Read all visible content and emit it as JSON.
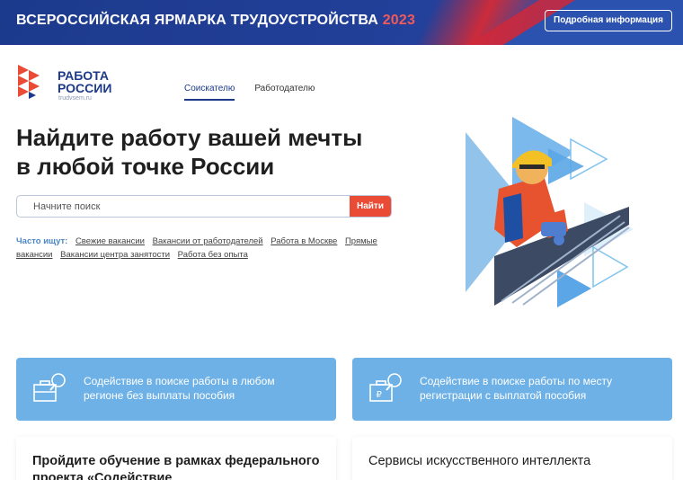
{
  "banner": {
    "title": "ВСЕРОССИЙСКАЯ ЯРМАРКА ТРУДОУСТРОЙСТВА",
    "year": "2023",
    "button": "Подробная информация"
  },
  "logo": {
    "line1": "РАБОТА",
    "line2": "РОССИИ",
    "sub": "trudvsem.ru"
  },
  "nav": {
    "tabs": [
      {
        "label": "Соискателю",
        "active": true
      },
      {
        "label": "Работодателю",
        "active": false
      }
    ]
  },
  "hero": {
    "title_line1": "Найдите работу вашей мечты",
    "title_line2": "в любой точке России"
  },
  "search": {
    "placeholder": "Начните поиск",
    "button": "Найти"
  },
  "often": {
    "label": "Часто ищут:",
    "links": [
      "Свежие вакансии",
      "Вакансии от работодателей",
      "Работа в Москве",
      "Прямые вакансии",
      "Вакансии центра занятости",
      "Работа без опыта"
    ]
  },
  "cards": [
    {
      "text": "Содействие в поиске работы в любом регионе без выплаты пособия",
      "icon": "briefcase-search-icon"
    },
    {
      "text": "Содействие в поиске работы по месту регистрации с выплатой пособия",
      "icon": "briefcase-ruble-search-icon"
    }
  ],
  "cards_white": [
    {
      "title": "Пройдите обучение в рамках федерального проекта «Содействие"
    },
    {
      "title": "Сервисы искусственного интеллекта"
    }
  ],
  "colors": {
    "brand_blue": "#1d3a8a",
    "accent_red": "#e94b35",
    "card_blue": "#6db1e6",
    "link_blue": "#4b86c6"
  }
}
